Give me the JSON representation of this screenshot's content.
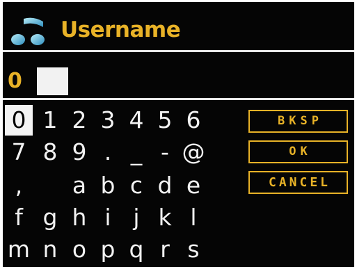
{
  "header": {
    "title": "Username",
    "icon": "music-note-icon",
    "accent_color": "#e8b227"
  },
  "entry": {
    "value": "0"
  },
  "keyboard": {
    "selected_key": "0",
    "rows": [
      [
        "0",
        "1",
        "2",
        "3",
        "4",
        "5",
        "6"
      ],
      [
        "7",
        "8",
        "9",
        ".",
        "_",
        "-",
        "@"
      ],
      [
        ",",
        "",
        "a",
        "b",
        "c",
        "d",
        "e"
      ],
      [
        "f",
        "g",
        "h",
        "i",
        "j",
        "k",
        "l"
      ],
      [
        "m",
        "n",
        "o",
        "p",
        "q",
        "r",
        "s"
      ]
    ]
  },
  "buttons": {
    "backspace": "BKSP",
    "ok": "OK",
    "cancel": "CANCEL"
  }
}
